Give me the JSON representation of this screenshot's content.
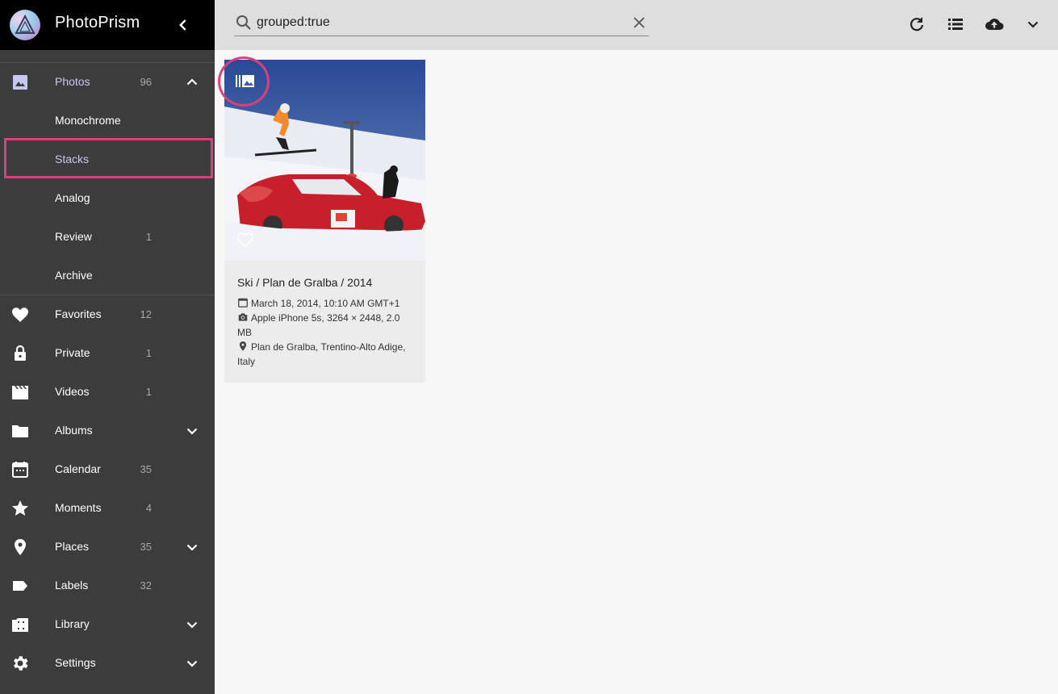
{
  "app": {
    "title": "PhotoPrism"
  },
  "colors": {
    "sidebar_bg": "#3c3c3c",
    "active_text": "#c7c8f0",
    "highlight": "#de3f7a"
  },
  "search": {
    "value": "grouped:true",
    "placeholder": ""
  },
  "sidebar": {
    "photos": {
      "label": "Photos",
      "count": "96"
    },
    "subitems": [
      {
        "label": "Monochrome"
      },
      {
        "label": "Stacks"
      },
      {
        "label": "Analog"
      },
      {
        "label": "Review",
        "count": "1"
      },
      {
        "label": "Archive"
      }
    ],
    "items": [
      {
        "label": "Favorites",
        "count": "12",
        "icon": "heart-icon"
      },
      {
        "label": "Private",
        "count": "1",
        "icon": "lock-icon"
      },
      {
        "label": "Videos",
        "count": "1",
        "icon": "film-icon"
      },
      {
        "label": "Albums",
        "count": "",
        "icon": "folder-icon"
      },
      {
        "label": "Calendar",
        "count": "35",
        "icon": "calendar-icon"
      },
      {
        "label": "Moments",
        "count": "4",
        "icon": "star-icon"
      },
      {
        "label": "Places",
        "count": "35",
        "icon": "place-pin-icon"
      },
      {
        "label": "Labels",
        "count": "32",
        "icon": "label-icon"
      },
      {
        "label": "Library",
        "count": "",
        "icon": "library-icon"
      },
      {
        "label": "Settings",
        "count": "",
        "icon": "gear-icon"
      }
    ]
  },
  "toolbar": {
    "icons": [
      "refresh-icon",
      "list-view-icon",
      "upload-icon",
      "chevron-down-icon"
    ]
  },
  "card": {
    "title": "Ski / Plan de Gralba / 2014",
    "date": "March 18, 2014, 10:10 AM GMT+1",
    "camera": "Apple iPhone 5s, 3264 × 2448, 2.0 MB",
    "location": "Plan de Gralba, Trentino-Alto Adige, Italy"
  }
}
